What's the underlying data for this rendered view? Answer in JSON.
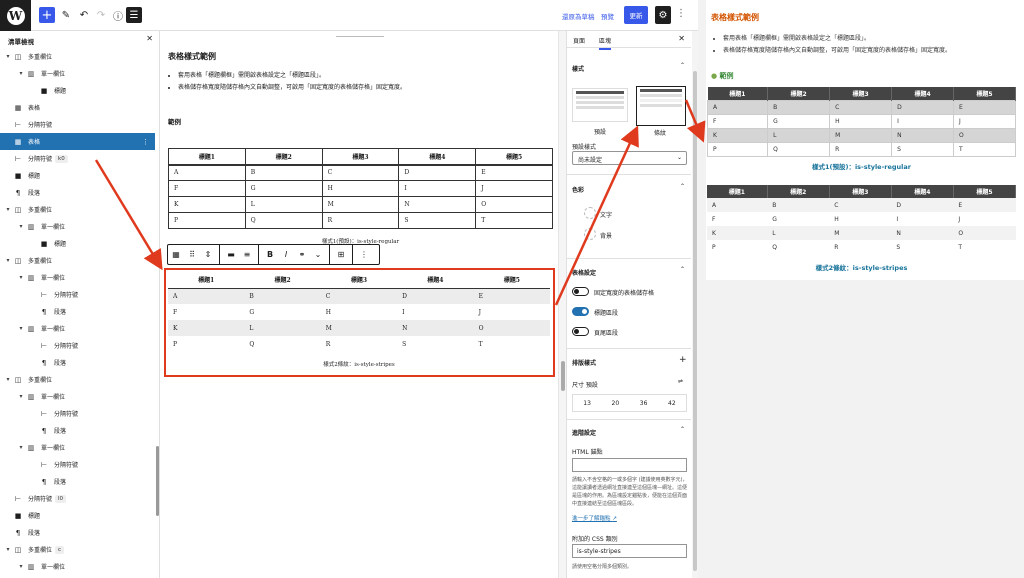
{
  "topbar": {
    "view_on_mobile": "還原為草稿",
    "preview": "預覽",
    "update": "更新"
  },
  "listview": {
    "title": "清單檢視",
    "items": [
      {
        "label": "多重欄位",
        "icon": "columns-icon",
        "chev": "▾",
        "indent": 0
      },
      {
        "label": "單一欄位",
        "icon": "column-icon",
        "chev": "▾",
        "indent": 1
      },
      {
        "label": "標題",
        "icon": "bookmark-icon",
        "chev": "",
        "indent": 2
      },
      {
        "label": "表格",
        "icon": "table-icon",
        "chev": "",
        "indent": 0
      },
      {
        "label": "分隔符號",
        "icon": "separator-icon",
        "chev": "",
        "indent": 0
      },
      {
        "label": "表格",
        "icon": "table-icon",
        "chev": "",
        "indent": 0,
        "selected": true
      },
      {
        "label": "分隔符號",
        "icon": "separator-icon",
        "chev": "",
        "indent": 0,
        "badge": "k0"
      },
      {
        "label": "標題",
        "icon": "bookmark-icon",
        "chev": "",
        "indent": 0
      },
      {
        "label": "段落",
        "icon": "paragraph-icon",
        "chev": "",
        "indent": 0
      },
      {
        "label": "多重欄位",
        "icon": "columns-icon",
        "chev": "▾",
        "indent": 0
      },
      {
        "label": "單一欄位",
        "icon": "column-icon",
        "chev": "▾",
        "indent": 1
      },
      {
        "label": "標題",
        "icon": "bookmark-icon",
        "chev": "",
        "indent": 2
      },
      {
        "label": "多重欄位",
        "icon": "columns-icon",
        "chev": "▾",
        "indent": 0
      },
      {
        "label": "單一欄位",
        "icon": "column-icon",
        "chev": "▾",
        "indent": 1
      },
      {
        "label": "分隔符號",
        "icon": "separator-icon",
        "chev": "",
        "indent": 2
      },
      {
        "label": "段落",
        "icon": "paragraph-icon",
        "chev": "",
        "indent": 2
      },
      {
        "label": "單一欄位",
        "icon": "column-icon",
        "chev": "▾",
        "indent": 1
      },
      {
        "label": "分隔符號",
        "icon": "separator-icon",
        "chev": "",
        "indent": 2
      },
      {
        "label": "段落",
        "icon": "paragraph-icon",
        "chev": "",
        "indent": 2
      },
      {
        "label": "多重欄位",
        "icon": "columns-icon",
        "chev": "▾",
        "indent": 0
      },
      {
        "label": "單一欄位",
        "icon": "column-icon",
        "chev": "▾",
        "indent": 1
      },
      {
        "label": "分隔符號",
        "icon": "separator-icon",
        "chev": "",
        "indent": 2
      },
      {
        "label": "段落",
        "icon": "paragraph-icon",
        "chev": "",
        "indent": 2
      },
      {
        "label": "單一欄位",
        "icon": "column-icon",
        "chev": "▾",
        "indent": 1
      },
      {
        "label": "分隔符號",
        "icon": "separator-icon",
        "chev": "",
        "indent": 2
      },
      {
        "label": "段落",
        "icon": "paragraph-icon",
        "chev": "",
        "indent": 2
      },
      {
        "label": "分隔符號",
        "icon": "separator-icon",
        "chev": "",
        "indent": 0,
        "badge": "l0"
      },
      {
        "label": "標題",
        "icon": "bookmark-icon",
        "chev": "",
        "indent": 0
      },
      {
        "label": "段落",
        "icon": "paragraph-icon",
        "chev": "",
        "indent": 0
      },
      {
        "label": "多重欄位",
        "icon": "columns-icon",
        "chev": "▾",
        "indent": 0,
        "badge": "c"
      },
      {
        "label": "單一欄位",
        "icon": "column-icon",
        "chev": "▾",
        "indent": 1
      }
    ]
  },
  "canvas": {
    "title": "表格樣式範例",
    "bullets": [
      "套用表格「標題欄框」需開啟表格設定之「標題區段」。",
      "表格儲存格寬度隨儲存格內文自動調整，可啟用「固定寬度的表格儲存格」固定寬度。"
    ],
    "example_heading": "範例",
    "headers": [
      "標題1",
      "標題2",
      "標題3",
      "標題4",
      "標題5"
    ],
    "rows": [
      [
        "A",
        "B",
        "C",
        "D",
        "E"
      ],
      [
        "F",
        "G",
        "H",
        "I",
        "J"
      ],
      [
        "K",
        "L",
        "M",
        "N",
        "O"
      ],
      [
        "P",
        "Q",
        "R",
        "S",
        "T"
      ]
    ],
    "caption1": "樣式1(預設)：is-style-regular",
    "caption2": "樣式2條紋：is-style-stripes"
  },
  "sidebar": {
    "tab_page": "頁面",
    "tab_block": "區塊",
    "styles_heading": "樣式",
    "style_default": "預設",
    "style_stripes": "條紋",
    "default_style_label": "預設樣式",
    "default_style_value": "尚未設定",
    "color_heading": "色彩",
    "color_text": "文字",
    "color_background": "背景",
    "table_settings_heading": "表格設定",
    "toggle_fixed": "固定寬度的表格儲存格",
    "toggle_header": "標題區段",
    "toggle_footer": "頁尾區段",
    "typography_heading": "排版樣式",
    "size_label": "尺寸 預設",
    "sizes": [
      "13",
      "20",
      "36",
      "42"
    ],
    "advanced_heading": "進階設定",
    "html_anchor_label": "HTML 錨點",
    "html_anchor_help": "請輸入不含空格的一或多個字 (建議使用英數字元)，這能讓讀者透過網址直接連至這個區塊—網址。這便是區塊的作用。為區塊設定錨點後，便能在這個頁面中直接連結至這個區塊區段。",
    "learn_more": "進一步了解錨點",
    "css_class_label": "附加的 CSS 類別",
    "css_class_value": "is-style-stripes",
    "css_class_help": "請使用空格分隔多個類別。"
  },
  "preview": {
    "title": "表格樣式範例",
    "bullets": [
      "套用表格「標題欄框」需開啟表格設定之「標題區段」。",
      "表格儲存格寬度隨儲存格內文自動調整，可啟用「固定寬度的表格儲存格」固定寬度。"
    ],
    "example_heading": "範例",
    "caption1": "樣式1(預設)：is-style-regular",
    "caption2": "樣式2條紋：is-style-stripes"
  },
  "colors": {
    "accent": "#3858e9",
    "selected": "#2271b1",
    "annotation_red": "#e03a1e",
    "preview_title": "#d35400",
    "preview_caption": "#17739a"
  }
}
